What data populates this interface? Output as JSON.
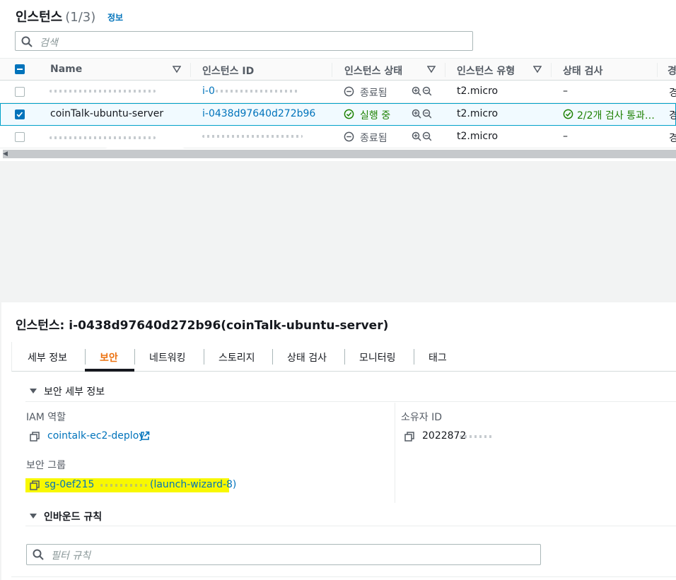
{
  "instances": {
    "title": "인스턴스",
    "count": "(1/3)",
    "info_link": "정보",
    "search_placeholder": "검색",
    "columns": [
      "Name",
      "인스턴스 ID",
      "인스턴스 상태",
      "인스턴스 유형",
      "상태 검사",
      "경"
    ],
    "rows": [
      {
        "name": "",
        "id": "i-0",
        "state": "종료됨",
        "type": "t2.micro",
        "check": "–",
        "extra": "경"
      },
      {
        "name": "coinTalk-ubuntu-server",
        "id": "i-0438d97640d272b96",
        "state": "실행 중",
        "type": "t2.micro",
        "check": "2/2개 검사 통과…",
        "extra": "경"
      },
      {
        "name": "",
        "id": "",
        "state": "종료됨",
        "type": "t2.micro",
        "check": "–",
        "extra": "경"
      }
    ]
  },
  "detail": {
    "title": "인스턴스: i-0438d97640d272b96(coinTalk-ubuntu-server)",
    "tabs": [
      "세부 정보",
      "보안",
      "네트워킹",
      "스토리지",
      "상태 검사",
      "모니터링",
      "태그"
    ],
    "active_tab": "보안",
    "security_section": "보안 세부 정보",
    "iam_label": "IAM 역할",
    "iam_value": "cointalk-ec2-deploy",
    "owner_label": "소유자 ID",
    "owner_value": "2022872",
    "sg_label": "보안 그룹",
    "sg_value_start": "sg-0ef215",
    "sg_value_end": "(launch-wizard-8)",
    "inbound_section": "인바운드 규칙",
    "filter_placeholder": "필터 규칙"
  },
  "colors": {
    "link": "#0073bb",
    "accent": "#ec7211",
    "success": "#1d8102",
    "highlight": "#f8f800"
  }
}
